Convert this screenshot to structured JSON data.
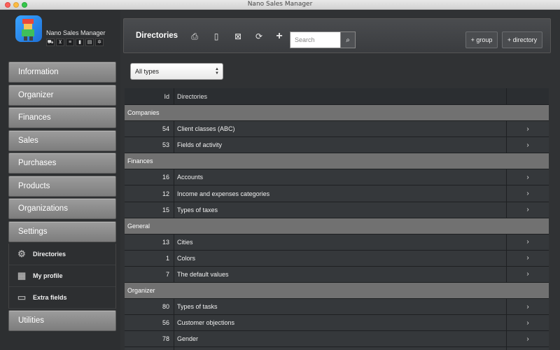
{
  "window": {
    "title": "Nano Sales Manager"
  },
  "app": {
    "name": "Nano Sales Manager"
  },
  "menu": {
    "information": "Information",
    "organizer": "Organizer",
    "finances": "Finances",
    "sales": "Sales",
    "purchases": "Purchases",
    "products": "Products",
    "organizations": "Organizations",
    "settings": "Settings",
    "utilities": "Utilities"
  },
  "settings_submenu": {
    "directories": "Directories",
    "my_profile": "My profile",
    "extra_fields": "Extra fields"
  },
  "toolbar": {
    "title": "Directories",
    "search_placeholder": "Search",
    "add_group": "+ group",
    "add_directory": "+ directory"
  },
  "filter": {
    "selected": "All types"
  },
  "table": {
    "columns": {
      "id": "Id",
      "name": "Directories"
    },
    "groups": [
      {
        "label": "Companies",
        "rows": [
          {
            "id": "54",
            "name": "Client classes (ABC)"
          },
          {
            "id": "53",
            "name": "Fields of activity"
          }
        ]
      },
      {
        "label": "Finances",
        "rows": [
          {
            "id": "16",
            "name": "Accounts"
          },
          {
            "id": "12",
            "name": "Income and expenses categories"
          },
          {
            "id": "15",
            "name": "Types of taxes"
          }
        ]
      },
      {
        "label": "General",
        "rows": [
          {
            "id": "13",
            "name": "Cities"
          },
          {
            "id": "1",
            "name": "Colors"
          },
          {
            "id": "7",
            "name": "The default values"
          }
        ]
      },
      {
        "label": "Organizer",
        "rows": [
          {
            "id": "80",
            "name": "Types of tasks"
          },
          {
            "id": "56",
            "name": "Customer objections"
          },
          {
            "id": "78",
            "name": "Gender"
          }
        ]
      }
    ]
  }
}
